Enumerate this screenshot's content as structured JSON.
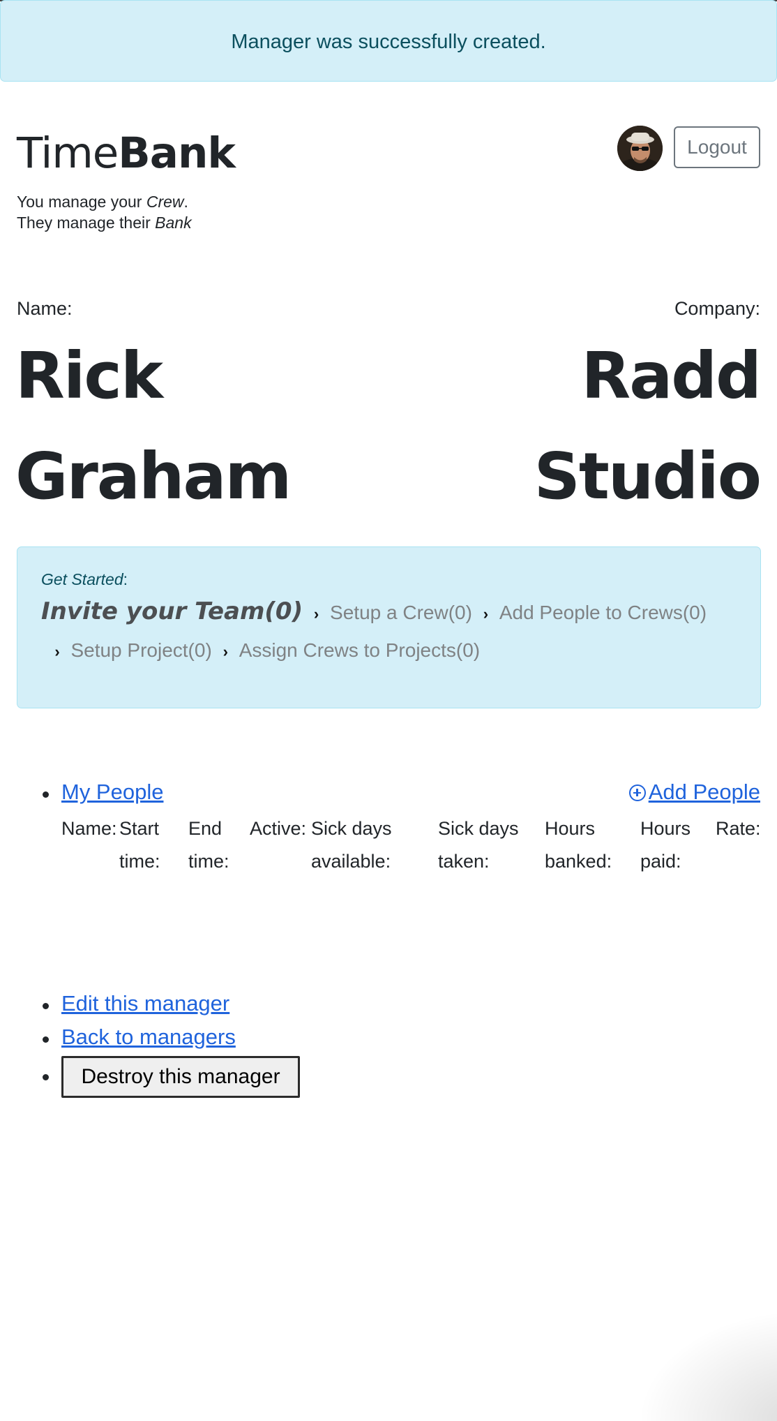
{
  "flash": {
    "message": "Manager was successfully created."
  },
  "header": {
    "brand_light": "Time",
    "brand_bold": "Bank",
    "tagline_1_prefix": "You manage your ",
    "tagline_1_em": "Crew",
    "tagline_1_suffix": ".",
    "tagline_2_prefix": "They manage their ",
    "tagline_2_em": "Bank",
    "logout_label": "Logout",
    "avatar_icon": "user-avatar-photo"
  },
  "manager": {
    "name_label": "Name:",
    "first_name": "Rick",
    "last_name": "Graham",
    "company_label": "Company:",
    "company_line_1": "Radd",
    "company_line_2": "Studio"
  },
  "get_started": {
    "title": "Get Started",
    "colon": ":",
    "steps": [
      "Invite your Team(0)",
      "Setup a Crew(0)",
      "Add People to Crews(0)",
      "Setup Project(0)",
      "Assign Crews to Projects(0)"
    ]
  },
  "people": {
    "my_people_label": "My People",
    "add_people_label": "Add People",
    "add_icon": "plus-circle-icon",
    "columns": [
      {
        "line1": "Name:",
        "line2": ""
      },
      {
        "line1": "Start",
        "line2": "time:"
      },
      {
        "line1": "End",
        "line2": "time:"
      },
      {
        "line1": "Active:",
        "line2": ""
      },
      {
        "line1": "Sick days",
        "line2": "available:"
      },
      {
        "line1": "Sick days",
        "line2": "taken:"
      },
      {
        "line1": "Hours",
        "line2": "banked:"
      },
      {
        "line1": "Hours",
        "line2": "paid:"
      },
      {
        "line1": "Rate:",
        "line2": ""
      }
    ]
  },
  "actions": {
    "edit_label": "Edit this manager",
    "back_label": "Back to managers",
    "destroy_label": "Destroy this manager"
  }
}
